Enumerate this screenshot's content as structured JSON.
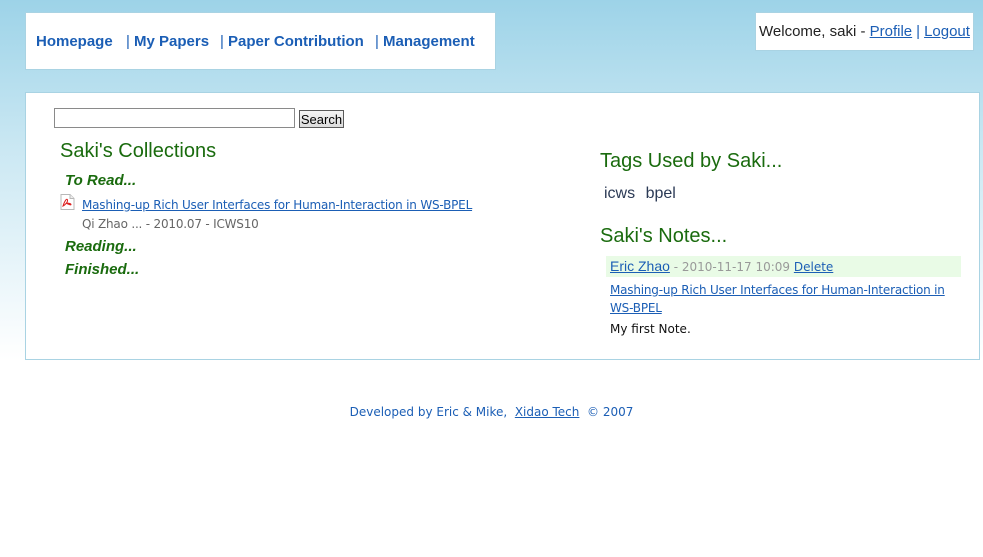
{
  "nav": {
    "items": [
      {
        "label": "Homepage"
      },
      {
        "label": "My Papers"
      },
      {
        "label": "Paper Contribution"
      },
      {
        "label": "Management"
      }
    ],
    "separator": "|"
  },
  "user": {
    "welcome": "Welcome, saki -",
    "profile_label": "Profile",
    "separator": "|",
    "logout_label": "Logout"
  },
  "search": {
    "value": "",
    "button_label": "Search"
  },
  "collections": {
    "title": "Saki's Collections",
    "to_read_label": "To Read...",
    "reading_label": "Reading...",
    "finished_label": "Finished...",
    "to_read_items": [
      {
        "title": "Mashing-up Rich User Interfaces for Human-Interaction in WS-BPEL",
        "meta": "Qi Zhao ... - 2010.07 - ICWS10",
        "icon": "pdf-icon"
      }
    ]
  },
  "tags": {
    "title": "Tags Used by Saki...",
    "items": [
      "icws",
      "bpel"
    ]
  },
  "notes": {
    "title": "Saki's Notes...",
    "items": [
      {
        "author": "Eric Zhao",
        "date": "- 2010-11-17 10:09",
        "delete_label": "Delete",
        "paper": "Mashing-up Rich User Interfaces for Human-Interaction in WS-BPEL",
        "text": "My first Note."
      }
    ]
  },
  "footer": {
    "prefix": "Developed by Eric & Mike,  ",
    "org_label": "Xidao Tech",
    "suffix": "  © 2007"
  },
  "colors": {
    "link": "#1b5eb5",
    "heading": "#1a6b0e",
    "border": "#a9d3e3"
  }
}
